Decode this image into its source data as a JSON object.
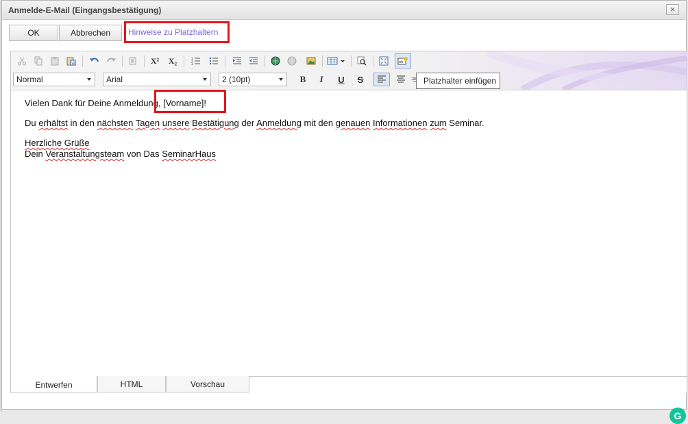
{
  "dialog": {
    "title": "Anmelde-E-Mail (Eingangsbestätigung)",
    "close_symbol": "×"
  },
  "buttons": {
    "ok": "OK",
    "cancel": "Abbrechen",
    "hint_link": "Hinweise zu Platzhaltern"
  },
  "toolbar": {
    "icons": [
      "cut-icon",
      "copy-icon",
      "paste-icon",
      "paste-word-icon",
      "undo-icon",
      "redo-icon",
      "paste-plain-icon",
      "superscript-icon",
      "subscript-icon",
      "numbered-list-icon",
      "bullet-list-icon",
      "indent-icon",
      "outdent-icon",
      "insert-link-icon",
      "remove-link-icon",
      "insert-image-icon",
      "insert-table-icon",
      "find-icon",
      "fullscreen-icon",
      "insert-placeholder-icon"
    ],
    "superscript_glyph": "X²",
    "subscript_glyph": "X₂",
    "paragraph_style": "Normal",
    "font_family": "Arial",
    "font_size": "2 (10pt)",
    "bold_glyph": "B",
    "italic_glyph": "I",
    "underline_glyph": "U",
    "strike_glyph": "S",
    "tooltip": "Platzhalter einfügen"
  },
  "content": {
    "line1_pre": "Vielen Dank für Deine Anmeldung, ",
    "line1_placeholder": "[Vorname]",
    "line1_post": "!",
    "line2": [
      {
        "t": "Du ",
        "s": false
      },
      {
        "t": "erhältst",
        "s": true
      },
      {
        "t": " in den ",
        "s": false
      },
      {
        "t": "nächsten",
        "s": true
      },
      {
        "t": " ",
        "s": false
      },
      {
        "t": "Tagen",
        "s": true
      },
      {
        "t": " ",
        "s": false
      },
      {
        "t": "unsere",
        "s": true
      },
      {
        "t": " ",
        "s": false
      },
      {
        "t": "Bestätigung",
        "s": true
      },
      {
        "t": " der ",
        "s": false
      },
      {
        "t": "Anmeldung",
        "s": true
      },
      {
        "t": " mit den ",
        "s": false
      },
      {
        "t": "genauen",
        "s": true
      },
      {
        "t": " ",
        "s": false
      },
      {
        "t": "Informationen",
        "s": true
      },
      {
        "t": " ",
        "s": false
      },
      {
        "t": "zum",
        "s": true
      },
      {
        "t": " Seminar.",
        "s": false
      }
    ],
    "greeting": "Herzliche Grüße",
    "signature_pre": "Dein ",
    "signature_team": "Veranstaltungsteam",
    "signature_mid": " von Das ",
    "signature_brand": "SeminarHaus"
  },
  "grammarly_letter": "G",
  "tabs": [
    "Entwerfen",
    "HTML",
    "Vorschau"
  ],
  "colors": {
    "highlight_red": "#e2161d",
    "link_purple": "#7b68d9",
    "grammarly_green": "#15c39a"
  }
}
